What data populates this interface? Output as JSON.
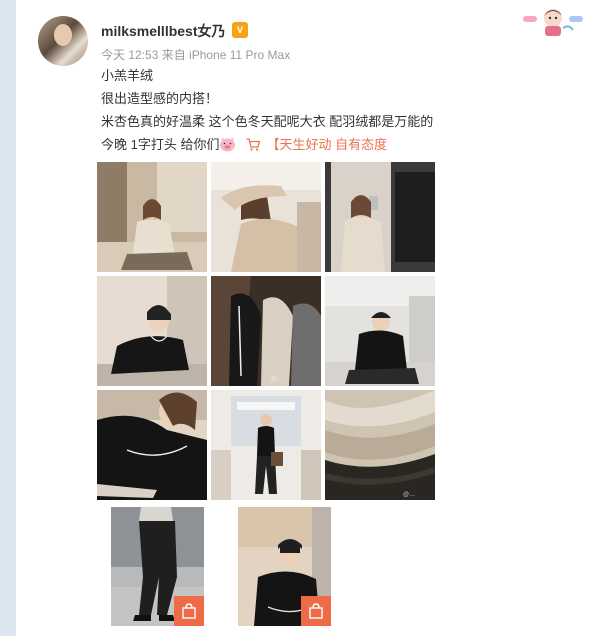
{
  "post": {
    "username": "milksmelllbest女乃",
    "badge_icon": "vip-badge-icon",
    "meta": "今天 12:53 来自 iPhone 11 Pro Max",
    "lines": [
      "小羔羊绒",
      "很出造型感的内搭！",
      "米杏色真的好温柔 这个色冬天配呢大衣 配羽绒都是万能的"
    ],
    "last_line_text": "今晚  1字打头 给你们",
    "emoji_icon": "pig-face-icon",
    "shop_icon": "cart-icon",
    "shop_link": "【天生好动 自有态度"
  },
  "colors": {
    "link": "#eb7350",
    "badge": "#ee6b47",
    "meta": "#9a9a9a"
  }
}
